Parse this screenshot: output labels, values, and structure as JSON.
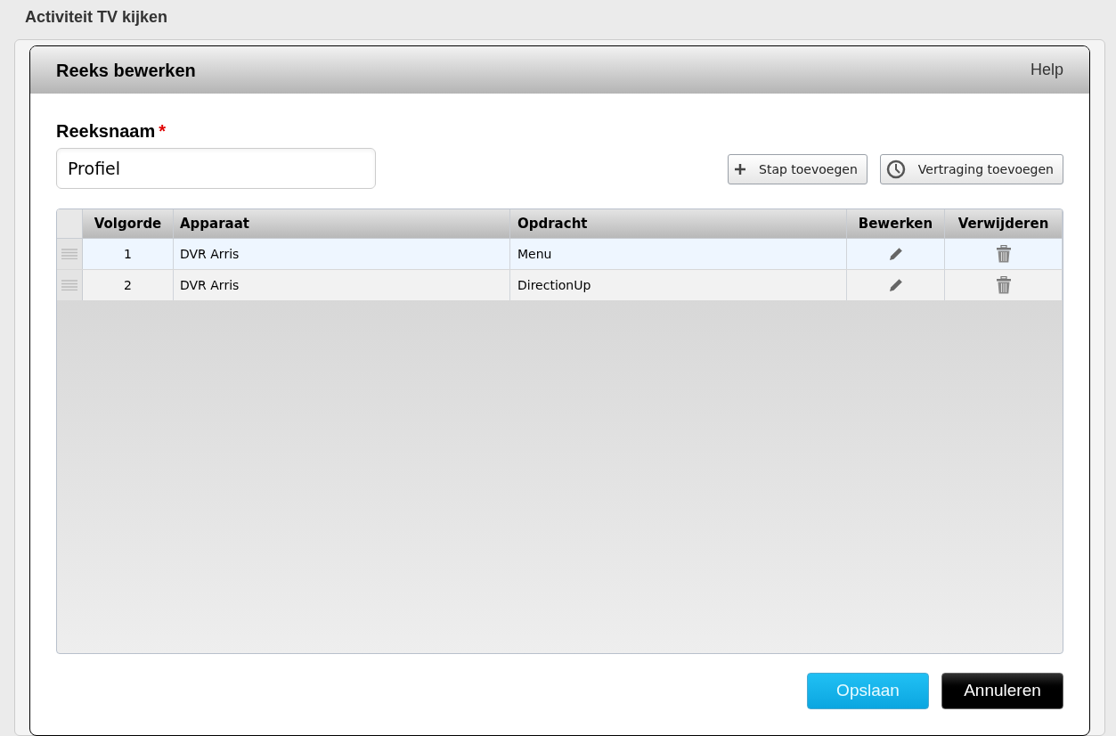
{
  "page": {
    "title": "Activiteit TV kijken"
  },
  "dialog": {
    "title": "Reeks bewerken",
    "help": "Help",
    "name_field": {
      "label": "Reeksnaam",
      "required_mark": "*",
      "value": "Profiel"
    },
    "toolbar": [
      {
        "kind": "add",
        "label": "Stap toevoegen"
      },
      {
        "kind": "delay",
        "label": "Vertraging toevoegen"
      }
    ],
    "table": {
      "columns": [
        "Volgorde",
        "Apparaat",
        "Opdracht",
        "Bewerken",
        "Verwijderen"
      ],
      "rows": [
        {
          "order": "1",
          "device": "DVR Arris",
          "command": "Menu",
          "selected": true
        },
        {
          "order": "2",
          "device": "DVR Arris",
          "command": "DirectionUp",
          "selected": false
        }
      ]
    },
    "buttons": [
      {
        "kind": "primary",
        "label": "Opslaan"
      },
      {
        "kind": "secondary",
        "label": "Annuleren"
      }
    ]
  }
}
